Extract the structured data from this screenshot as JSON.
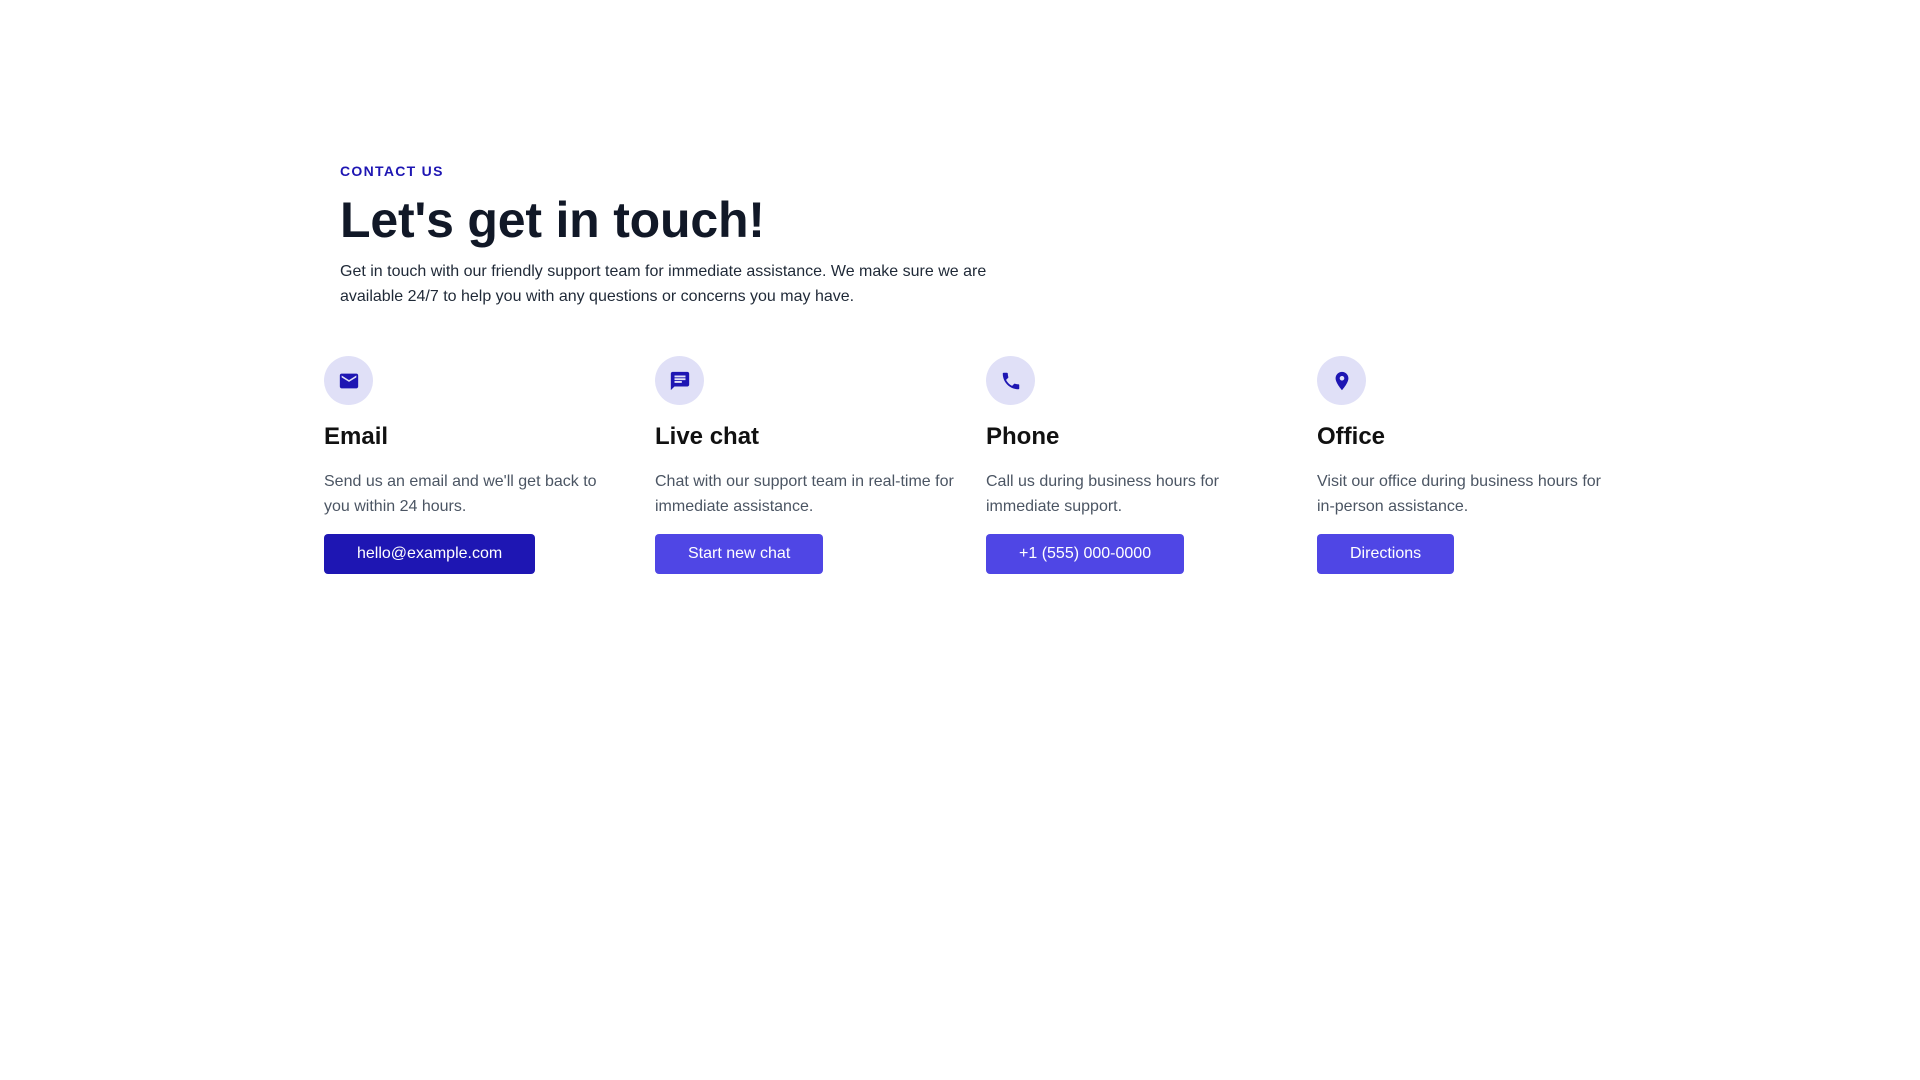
{
  "header": {
    "eyebrow": "CONTACT US",
    "title": "Let's get in touch!",
    "subtitle": "Get in touch with our friendly support team for immediate assistance. We make sure we are available 24/7 to help you with any questions or concerns you may have."
  },
  "colors": {
    "accent": "#1e16b3",
    "button": "#4f46e5",
    "icon_bg": "#e0e0f7",
    "heading": "#111827",
    "body_text": "#4b5563"
  },
  "cards": [
    {
      "icon": "mail-icon",
      "title": "Email",
      "description": "Send us an email and we'll get back to you within 24 hours.",
      "button_label": "hello@example.com"
    },
    {
      "icon": "chat-icon",
      "title": "Live chat",
      "description": "Chat with our support team in real-time for immediate assistance.",
      "button_label": "Start new chat"
    },
    {
      "icon": "phone-icon",
      "title": "Phone",
      "description": "Call us during business hours for immediate support.",
      "button_label": "+1 (555) 000-0000"
    },
    {
      "icon": "location-pin-icon",
      "title": "Office",
      "description": "Visit our office during business hours for in-person assistance.",
      "button_label": "Directions"
    }
  ]
}
